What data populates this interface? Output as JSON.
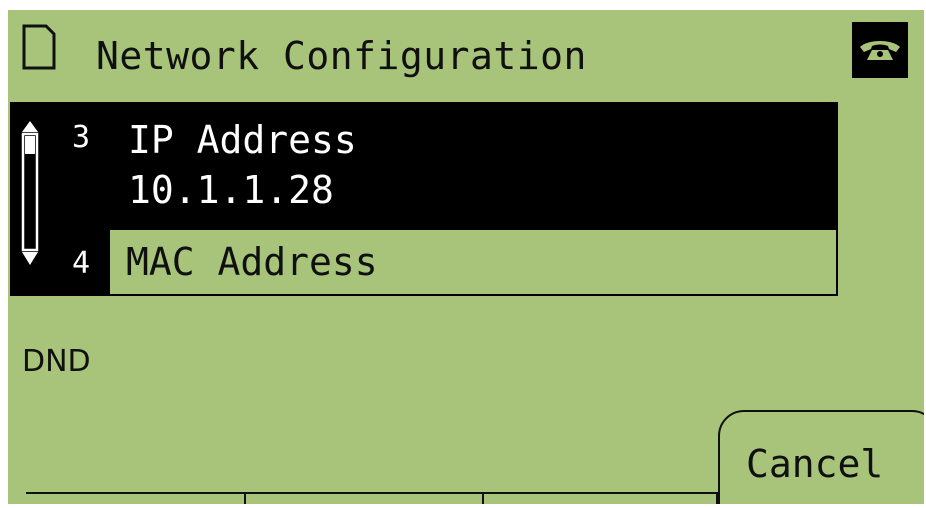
{
  "header": {
    "title": "Network Configuration",
    "left_icon": "document-icon",
    "right_icon": "phone-handset-icon"
  },
  "menu": {
    "items": [
      {
        "number": "3",
        "label": "IP Address",
        "value": "10.1.1.28",
        "selected": true
      },
      {
        "number": "4",
        "label": "MAC Address",
        "selected": false
      }
    ]
  },
  "status": {
    "dnd": "DND"
  },
  "softkeys": {
    "cancel": "Cancel"
  },
  "colors": {
    "lcd_background": "#a8c47a",
    "highlight": "#000000",
    "text": "#101010",
    "highlight_text": "#ffffff"
  }
}
